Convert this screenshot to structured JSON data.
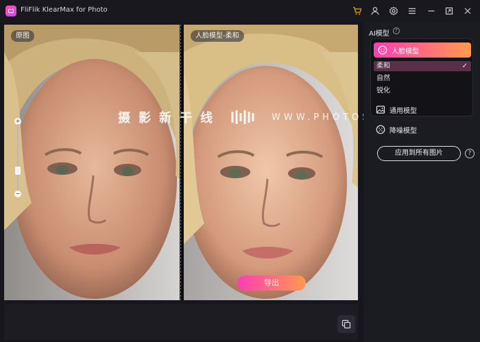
{
  "app": {
    "title": "FliFlik KlearMax for Photo"
  },
  "titlebar_icons": [
    "cart-icon",
    "user-icon",
    "gear-icon",
    "menu-icon",
    "minimize-icon",
    "maximize-icon",
    "close-icon"
  ],
  "colors": {
    "accent_start": "#ff3db4",
    "accent_end": "#ff9a4d",
    "background": "#16161c",
    "panel": "#1b1b22"
  },
  "preview": {
    "original_label": "原图",
    "enhanced_label": "人脸模型-柔和",
    "export_label": "导出",
    "zoom": {
      "plus": "+",
      "minus": "−",
      "level": 0.3
    }
  },
  "watermark": {
    "text": "摄影新干线",
    "url": "WWW.PHOTOSKS.VIP"
  },
  "panel": {
    "title": "AI模型",
    "help": "?",
    "face_model": {
      "label": "人脸模型",
      "options": [
        "柔和",
        "自然",
        "锐化"
      ],
      "selected": "柔和"
    },
    "general_model": "通用模型",
    "denoise_model": "降噪模型",
    "apply_all": "应用到所有图片",
    "apply_help": "?"
  }
}
